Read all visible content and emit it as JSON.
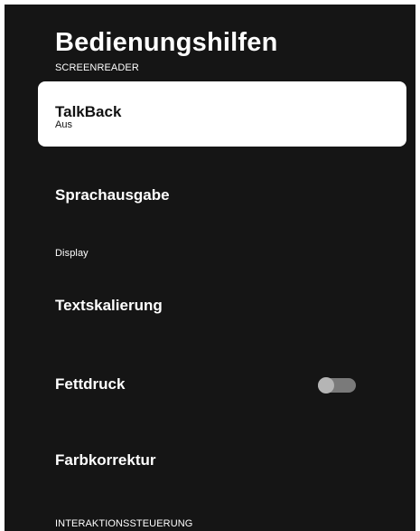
{
  "page": {
    "title": "Bedienungshilfen"
  },
  "sections": {
    "screenreader": "SCREENREADER",
    "display": "Display",
    "interaction": "INTERAKTIONSSTEUERUNG"
  },
  "items": {
    "talkback": {
      "label": "TalkBack",
      "value": "Aus"
    },
    "speech_output": {
      "label": "Sprachausgabe"
    },
    "text_scaling": {
      "label": "Textskalierung"
    },
    "bold_text": {
      "label": "Fettdruck",
      "enabled": false
    },
    "color_correction": {
      "label": "Farbkorrektur"
    }
  },
  "colors": {
    "background": "#151515",
    "focus": "#ffffff",
    "toggle_track": "#7a7a7a",
    "toggle_knob": "#b5b5b5"
  }
}
